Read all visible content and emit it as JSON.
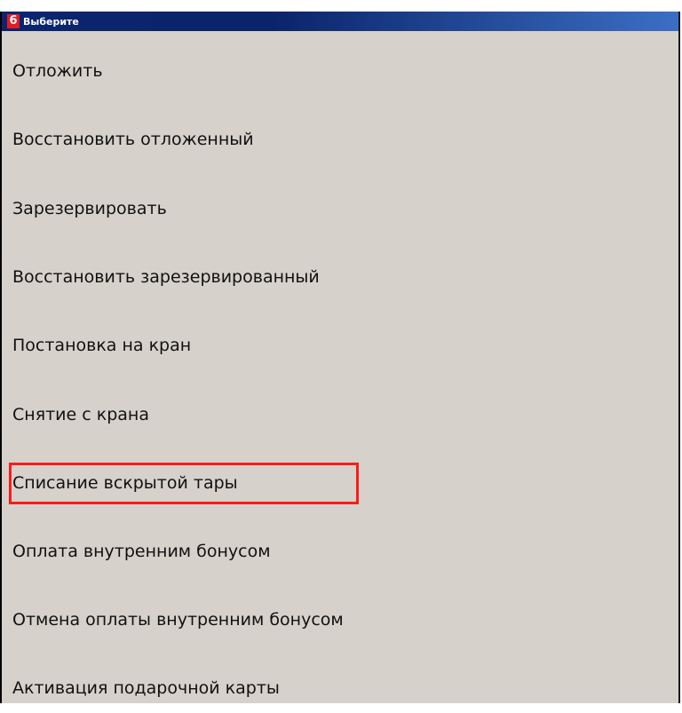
{
  "window": {
    "badge": "6",
    "title": "Выберите"
  },
  "menu": {
    "items": [
      {
        "label": "Отложить"
      },
      {
        "label": "Восстановить отложенный"
      },
      {
        "label": "Зарезервировать"
      },
      {
        "label": "Восстановить зарезервированный"
      },
      {
        "label": "Постановка на кран"
      },
      {
        "label": "Снятие с крана"
      },
      {
        "label": "Списание вскрытой тары",
        "highlighted": true
      },
      {
        "label": "Оплата внутренним бонусом"
      },
      {
        "label": "Отмена оплаты внутренним бонусом"
      },
      {
        "label": "Активация подарочной карты"
      }
    ]
  },
  "colors": {
    "titlebar": "#0a246a",
    "window_bg": "#d6d2cb",
    "badge_bg": "#e31b23",
    "highlight": "#ff1a1a"
  }
}
